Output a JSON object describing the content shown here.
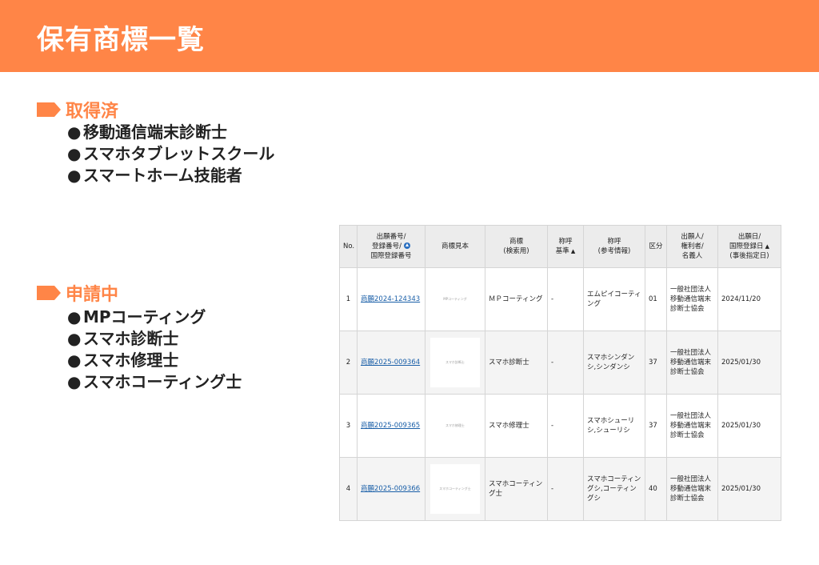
{
  "header": {
    "title": "保有商標一覧"
  },
  "sections": [
    {
      "title": "取得済",
      "items": [
        "移動通信端末診断士",
        "スマホタブレットスクール",
        "スマートホーム技能者"
      ]
    },
    {
      "title": "申請中",
      "items": [
        "MPコーティング",
        "スマホ診断士",
        "スマホ修理士",
        "スマホコーティング士"
      ]
    }
  ],
  "bullet": "●",
  "table": {
    "headers": {
      "no": "No.",
      "number_1": "出願番号/",
      "number_2": "登録番号/",
      "number_3": "国際登録番号",
      "image": "商標見本",
      "mark_1": "商標",
      "mark_2": "(検索用)",
      "basis_1": "称呼",
      "basis_2": "基準",
      "reading_1": "称呼",
      "reading_2": "(参考情報)",
      "class": "区分",
      "applicant_1": "出願人/",
      "applicant_2": "権利者/",
      "applicant_3": "名義人",
      "date_1": "出願日/",
      "date_2": "国際登録日",
      "date_3": "(事後指定日)",
      "sort_asc": "▲"
    },
    "rows": [
      {
        "no": "1",
        "number": "商願2024-124343",
        "image_text": "MPコーティング",
        "mark": "ＭＰコーティング",
        "basis": "-",
        "reading": "エムピイコーティング",
        "class": "01",
        "applicant": "一般社団法人移動通信端末診断士協会",
        "date": "2024/11/20"
      },
      {
        "no": "2",
        "number": "商願2025-009364",
        "image_text": "スマホ診断士",
        "mark": "スマホ診断士",
        "basis": "-",
        "reading": "スマホシンダンシ,シンダンシ",
        "class": "37",
        "applicant": "一般社団法人移動通信端末診断士協会",
        "date": "2025/01/30"
      },
      {
        "no": "3",
        "number": "商願2025-009365",
        "image_text": "スマホ修理士",
        "mark": "スマホ修理士",
        "basis": "-",
        "reading": "スマホシューリシ,シューリシ",
        "class": "37",
        "applicant": "一般社団法人移動通信端末診断士協会",
        "date": "2025/01/30"
      },
      {
        "no": "4",
        "number": "商願2025-009366",
        "image_text": "スマホコーティング士",
        "mark": "スマホコーティング士",
        "basis": "-",
        "reading": "スマホコーティングシ,コーティングシ",
        "class": "40",
        "applicant": "一般社団法人移動通信端末診断士協会",
        "date": "2025/01/30"
      }
    ]
  },
  "colors": {
    "accent": "#ff8547",
    "link": "#1a5fa8",
    "header_bg": "#ececec"
  }
}
